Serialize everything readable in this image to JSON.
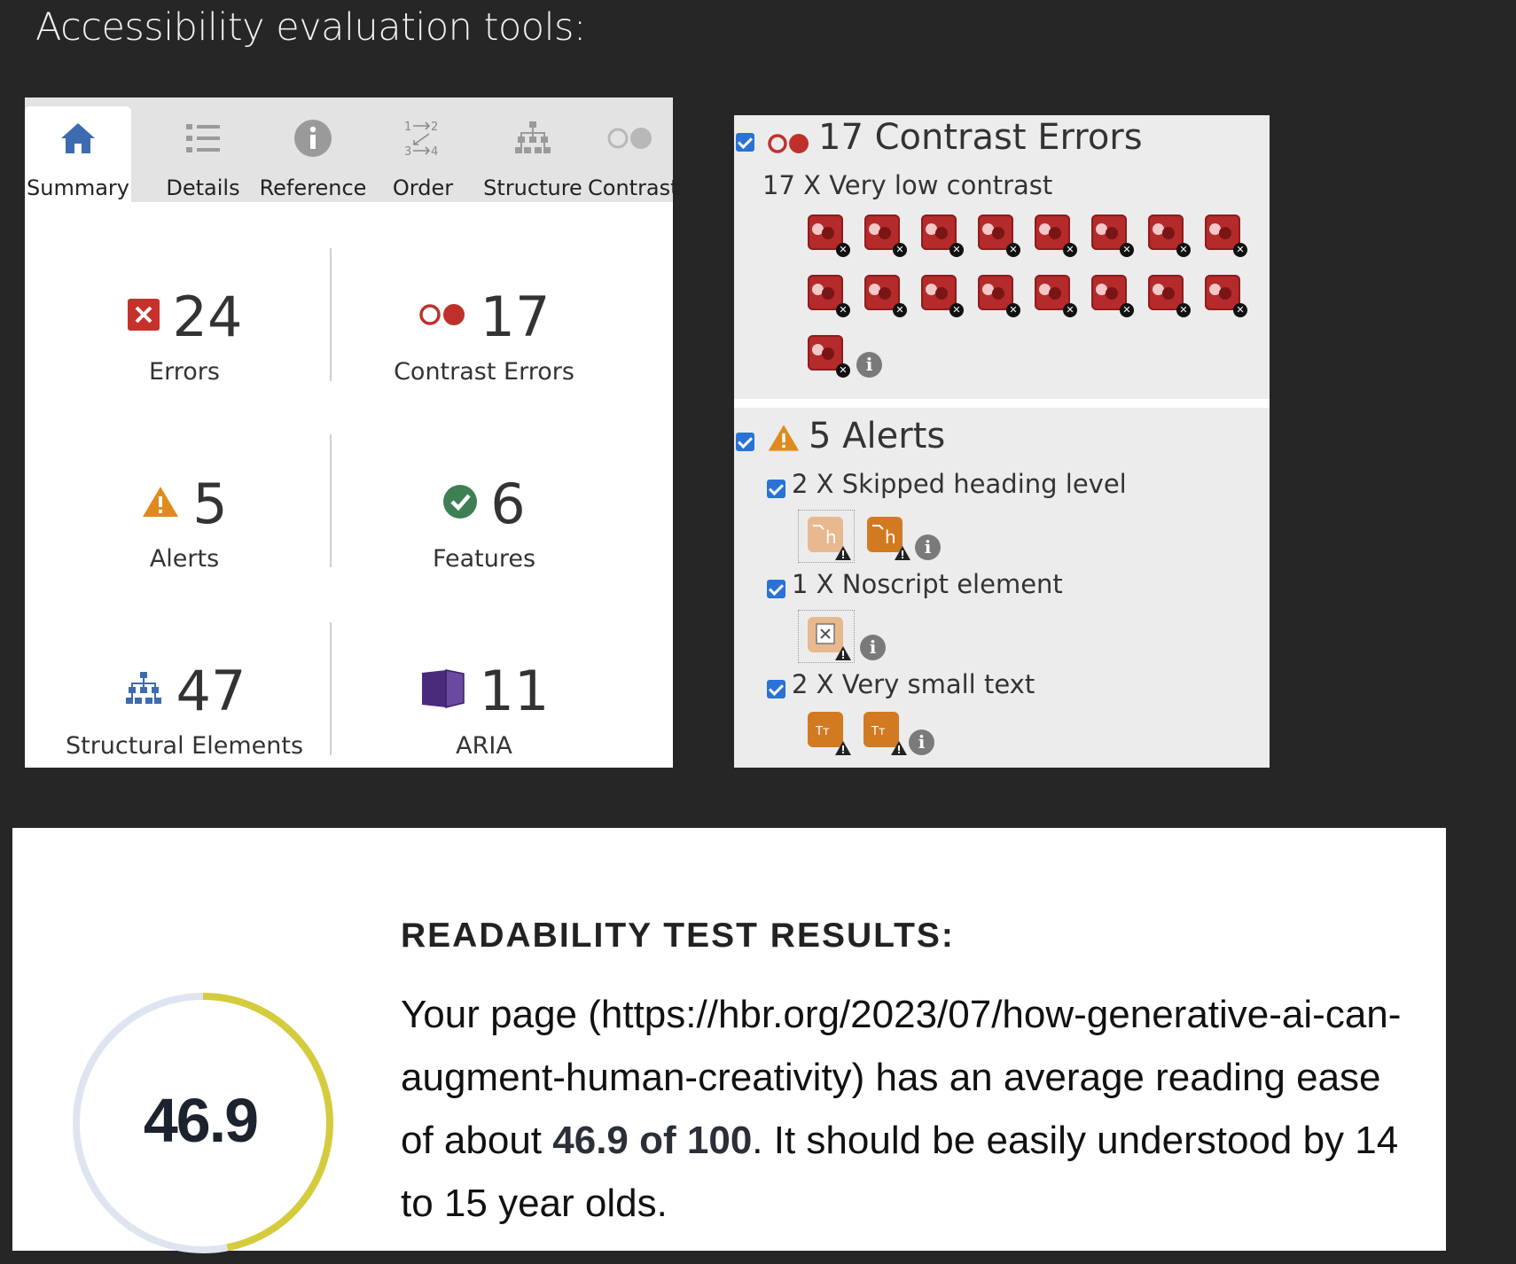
{
  "page_title": "Accessibility evaluation tools:",
  "wave_summary": {
    "tabs": [
      {
        "label": "Summary",
        "icon": "home-icon"
      },
      {
        "label": "Details",
        "icon": "list-icon"
      },
      {
        "label": "Reference",
        "icon": "info-icon"
      },
      {
        "label": "Order",
        "icon": "order-icon"
      },
      {
        "label": "Structure",
        "icon": "structure-icon"
      },
      {
        "label": "Contrast",
        "icon": "contrast-icon"
      }
    ],
    "stats": {
      "errors": {
        "value": "24",
        "label": "Errors"
      },
      "contrast": {
        "value": "17",
        "label": "Contrast Errors"
      },
      "alerts": {
        "value": "5",
        "label": "Alerts"
      },
      "features": {
        "value": "6",
        "label": "Features"
      },
      "structure": {
        "value": "47",
        "label": "Structural Elements"
      },
      "aria": {
        "value": "11",
        "label": "ARIA"
      }
    },
    "colors": {
      "error": "#c8302b",
      "contrast": "#c0302b",
      "alert": "#e08a1e",
      "feature": "#3e7f54",
      "structure": "#3c6bb0",
      "aria": "#4a2a7a"
    }
  },
  "wave_details": {
    "contrast_heading": "17 Contrast Errors",
    "contrast_item": "17 X Very low contrast",
    "contrast_icon_count": 17,
    "alerts_heading": "5 Alerts",
    "alert_items": [
      {
        "label": "2 X Skipped heading level"
      },
      {
        "label": "1 X Noscript element"
      },
      {
        "label": "2 X Very small text"
      }
    ],
    "colors": {
      "checkbox": "#2a72d5",
      "contrast_icon": "#b52a2a",
      "alert_icon": "#d27a22"
    }
  },
  "readability": {
    "heading": "READABILITY TEST RESULTS:",
    "body_before": "Your page (https://hbr.org/2023/07/how-generative-ai-can-augment-human-creativity) has an average reading ease of about ",
    "body_bold": "46.9 of 100",
    "body_after": ". It should be easily understood by 14 to 15 year olds.",
    "score_display": "46.9",
    "score": 46.9,
    "score_max": 100,
    "colors": {
      "ring_fill": "#d4cc3c",
      "ring_track": "#dfe5f0"
    }
  }
}
